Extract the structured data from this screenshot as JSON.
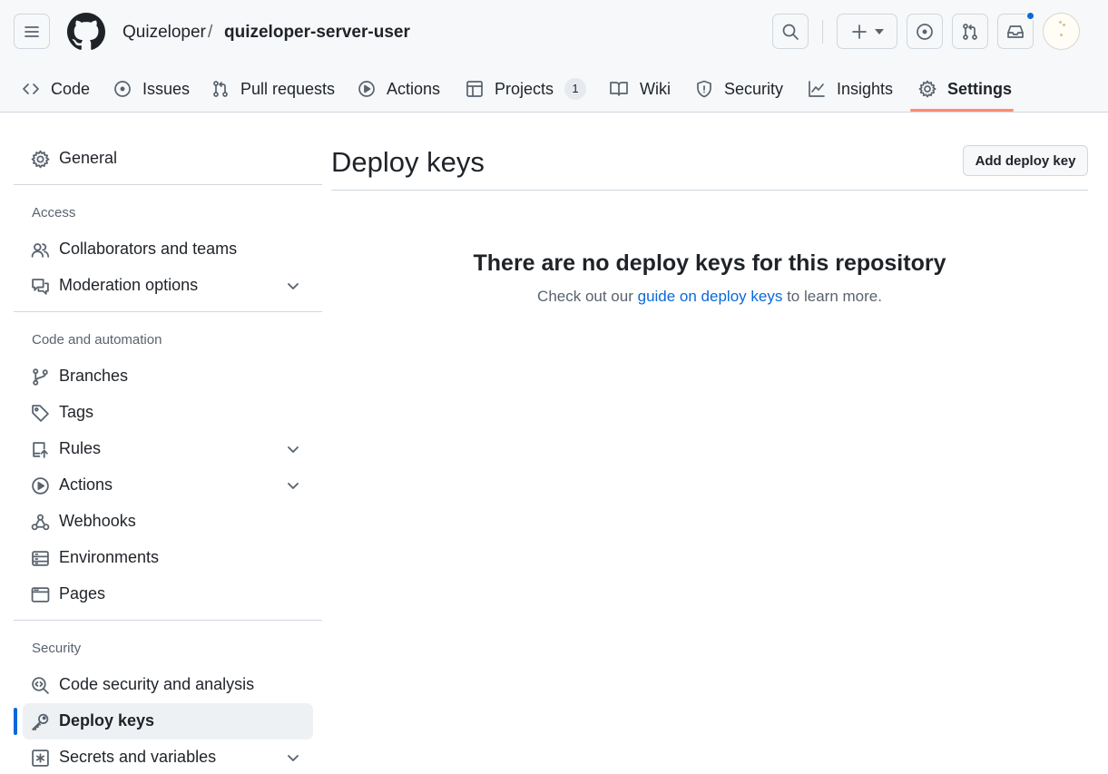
{
  "header": {
    "owner": "Quizeloper",
    "separator": "/",
    "repo": "quizeloper-server-user",
    "icons": [
      "menu-icon",
      "github-logo",
      "search-icon",
      "plus-icon",
      "triangle-down-icon",
      "issue-opened-icon",
      "git-pull-request-icon",
      "inbox-icon"
    ]
  },
  "tabs": [
    {
      "label": "Code",
      "icon": "code-icon"
    },
    {
      "label": "Issues",
      "icon": "issue-opened-icon"
    },
    {
      "label": "Pull requests",
      "icon": "git-pull-request-icon"
    },
    {
      "label": "Actions",
      "icon": "play-icon"
    },
    {
      "label": "Projects",
      "icon": "table-icon",
      "count": "1"
    },
    {
      "label": "Wiki",
      "icon": "book-icon"
    },
    {
      "label": "Security",
      "icon": "shield-icon"
    },
    {
      "label": "Insights",
      "icon": "graph-icon"
    },
    {
      "label": "Settings",
      "icon": "gear-icon",
      "active": true
    }
  ],
  "sidebar": {
    "general": "General",
    "access_heading": "Access",
    "access": [
      "Collaborators and teams",
      "Moderation options"
    ],
    "code_heading": "Code and automation",
    "code": [
      "Branches",
      "Tags",
      "Rules",
      "Actions",
      "Webhooks",
      "Environments",
      "Pages"
    ],
    "security_heading": "Security",
    "security": [
      "Code security and analysis",
      "Deploy keys",
      "Secrets and variables"
    ]
  },
  "main": {
    "title": "Deploy keys",
    "add_button": "Add deploy key",
    "blank_title": "There are no deploy keys for this repository",
    "blank_prefix": "Check out our ",
    "blank_link": "guide on deploy keys",
    "blank_suffix": " to learn more."
  },
  "colors": {
    "accent_blue": "#0969da",
    "tab_underline": "#fd8c73",
    "header_bg": "#f6f8fa",
    "border": "#d0d7de",
    "muted_text": "#59636e"
  }
}
